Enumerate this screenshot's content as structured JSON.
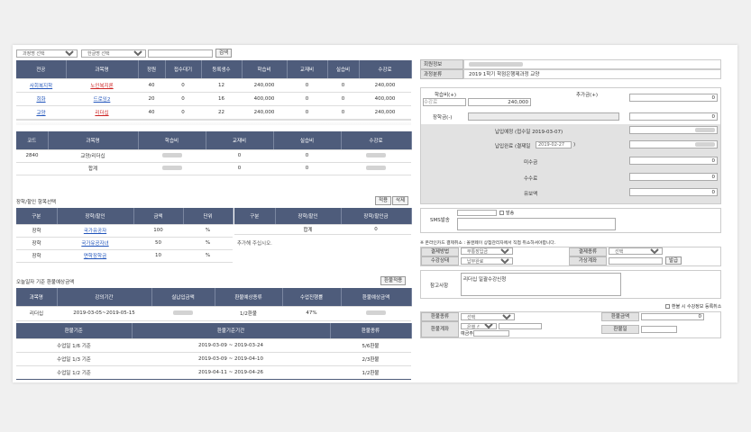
{
  "top": {
    "course_group_placeholder": "과정명 선택",
    "course_placeholder": "한글명 선택",
    "search_btn": "검색"
  },
  "main_table": {
    "headers": [
      "전공",
      "과목명",
      "정원",
      "접수대기",
      "등록생수",
      "학습비",
      "교재비",
      "실습비",
      "수강료"
    ],
    "rows": [
      {
        "major": "사회복지학",
        "subject": "노인복지론",
        "cap": "40",
        "wait": "0",
        "reg": "12",
        "fee": "240,000",
        "book": "0",
        "lab": "0",
        "tuition": "240,000"
      },
      {
        "major": "회화",
        "subject": "드로잉2",
        "cap": "20",
        "wait": "0",
        "reg": "16",
        "fee": "400,000",
        "book": "0",
        "lab": "0",
        "tuition": "400,000"
      },
      {
        "major": "교양",
        "subject": "리더십",
        "cap": "40",
        "wait": "0",
        "reg": "22",
        "fee": "240,000",
        "book": "0",
        "lab": "0",
        "tuition": "240,000"
      }
    ]
  },
  "sel_table": {
    "headers": [
      "코드",
      "과목명",
      "학습비",
      "교재비",
      "실습비",
      "수강료"
    ],
    "row": {
      "code": "2840",
      "subject": "교양/리더십",
      "book": "0",
      "lab": "0"
    },
    "total": {
      "label": "합계",
      "book": "0",
      "lab": "0"
    }
  },
  "discount": {
    "title": "장학/할인 항목선택",
    "apply_btn": "적용",
    "delete_btn": "삭제",
    "left_headers": [
      "구분",
      "장학/할인",
      "금액",
      "단위"
    ],
    "left_rows": [
      {
        "type": "장학",
        "name": "국가유공자",
        "amount": "100",
        "unit": "%"
      },
      {
        "type": "장학",
        "name": "국가유공자녀",
        "amount": "50",
        "unit": "%"
      },
      {
        "type": "장학",
        "name": "면학장학금",
        "amount": "10",
        "unit": "%"
      }
    ],
    "right_headers": [
      "구분",
      "장학/할인",
      "장학/할인금"
    ],
    "right_total_label": "합계",
    "right_total_value": "0",
    "right_hint": "추가해 주십시오."
  },
  "refund": {
    "title": "오늘일자 기준 환불예상금액",
    "btn": "환불적용",
    "headers": [
      "과목명",
      "강의기간",
      "실납입금액",
      "환불예상종류",
      "수업진행률",
      "환불예상금액"
    ],
    "row": {
      "subject": "리더십",
      "period": "2019-03-05~2019-05-15",
      "type": "1/2환불",
      "progress": "47%"
    },
    "std_headers": [
      "환불기준",
      "환불기준기간",
      "환불종류"
    ],
    "std_rows": [
      {
        "basis": "수업일 1/6 기준",
        "period": "2019-03-09 ~ 2019-03-24",
        "kind": "5/6환불"
      },
      {
        "basis": "수업일 1/3 기준",
        "period": "2019-03-09 ~ 2019-04-10",
        "kind": "2/3환불"
      },
      {
        "basis": "수업일 1/2 기준",
        "period": "2019-04-11 ~ 2019-04-26",
        "kind": "1/2환불"
      }
    ]
  },
  "right": {
    "member_label": "회원정보",
    "course_label": "과정분류",
    "course_value": "2019 1학기 학점은행제과정 교양",
    "fee_label": "학습비(+)",
    "fee_sub": "수강료",
    "fee_value": "240,000",
    "add_label": "추가금(+)",
    "add_value": "0",
    "scholar_label": "장학금(-)",
    "scholar_value": "0",
    "due_label": "납입예정 (접수일 2019-03-07)",
    "paid_label": "납입완료 (결제일",
    "paid_date": "2019-02-27",
    "unpaid_label": "미수금",
    "unpaid_value": "0",
    "fee2_label": "수수료",
    "fee2_value": "0",
    "credit_label": "유보액",
    "credit_value": "0",
    "sms_label": "SMS발송",
    "sms_check": "발송",
    "notice": "※ 온라인카드 결제취소 : 올앤페이 상점관리자에서 직접 취소하셔야합니다.",
    "pay_method_label": "결제방법",
    "pay_method_value": "무통장입금",
    "pay_kind_label": "결제종류",
    "pay_kind_value": "선택",
    "status_label": "수강상태",
    "status_value": "납부완료",
    "account_label": "가상계좌",
    "issue_btn": "발급",
    "memo_label": "참고사항",
    "memo_value": "리더십 일괄수강신청",
    "refund_check": "환불 시 수강정보 등록취소",
    "refund_kind_label": "환불종류",
    "refund_kind_value": "선택",
    "refund_amount_label": "환불금액",
    "refund_amount_value": "0",
    "refund_account_label": "환불계좌",
    "bank_value": "은행 선택",
    "holder_label": "예금주",
    "refund_date_label": "환불일"
  }
}
